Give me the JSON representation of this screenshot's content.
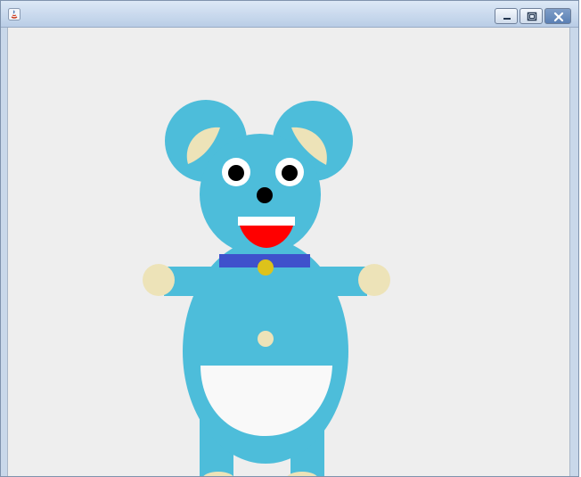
{
  "window": {
    "title": ""
  },
  "titlebar": {
    "controls": [
      "minimize",
      "maximize",
      "close"
    ]
  },
  "colors": {
    "bear_body": "#4dbdda",
    "ear_inner": "#ede3b8",
    "eye_white": "#ffffff",
    "pupil": "#000000",
    "mouth": "#ff0000",
    "teeth": "#ffffff",
    "collar": "#3f51cc",
    "bell": "#ddc21b",
    "paws": "#ede3b8",
    "belly": "#f9f9f9",
    "canvas_bg": "#eeeeee"
  },
  "icons": [
    "java-app-icon",
    "minimize-icon",
    "maximize-icon",
    "close-icon"
  ]
}
